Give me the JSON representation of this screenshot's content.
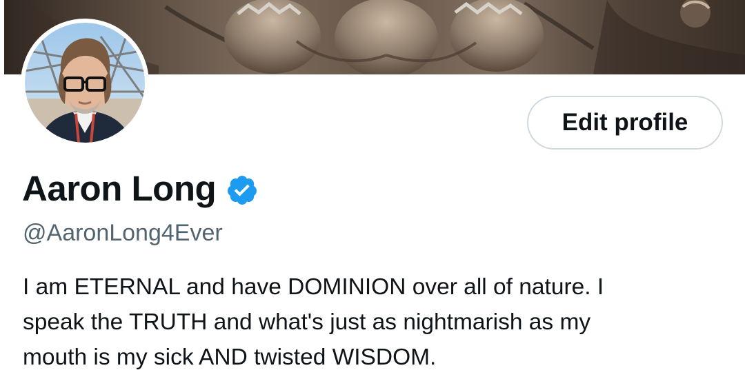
{
  "profile": {
    "display_name": "Aaron Long",
    "handle": "@AaronLong4Ever",
    "verified": true,
    "bio_lines": [
      "I am ETERNAL and have DOMINION over all of nature.  I",
      "speak the TRUTH and what's just as nightmarish as my",
      "mouth is my sick AND twisted WISDOM."
    ]
  },
  "actions": {
    "edit_profile_label": "Edit profile"
  },
  "icons": {
    "verified": "verified-badge-icon",
    "avatar": "profile-photo",
    "banner": "header-artwork"
  },
  "colors": {
    "verified_blue": "#1d9bf0",
    "text_primary": "#0f1419",
    "text_secondary": "#536471",
    "button_border": "#cfd9de"
  }
}
